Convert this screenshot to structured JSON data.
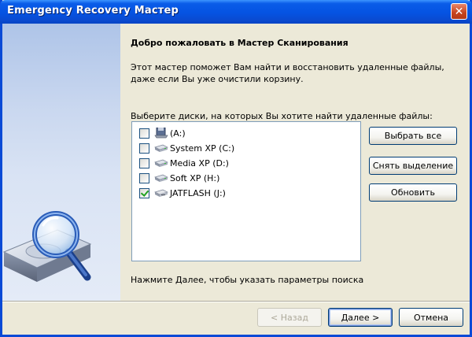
{
  "window": {
    "title": "Emergency Recovery Мастер",
    "close_glyph": "✕"
  },
  "content": {
    "heading": "Добро пожаловать в Мастер Сканирования",
    "description": "Этот мастер поможет Вам найти и восстановить удаленные файлы, даже если Вы уже очистили корзину.",
    "list_label": "Выберите диски, на которых Вы хотите найти удаленные файлы:",
    "drives": [
      {
        "label": "(A:)",
        "checked": false,
        "icon": "floppy-drive-icon"
      },
      {
        "label": "System XP (C:)",
        "checked": false,
        "icon": "hard-drive-icon"
      },
      {
        "label": "Media XP (D:)",
        "checked": false,
        "icon": "hard-drive-icon"
      },
      {
        "label": "Soft XP (H:)",
        "checked": false,
        "icon": "hard-drive-icon"
      },
      {
        "label": "JATFLASH (J:)",
        "checked": true,
        "icon": "removable-drive-icon"
      }
    ],
    "select_all_label": "Выбрать все",
    "deselect_label": "Снять выделение",
    "refresh_label": "Обновить",
    "hint": "Нажмите Далее, чтобы указать параметры поиска"
  },
  "footer": {
    "back_label": "< Назад",
    "next_label": "Далее >",
    "cancel_label": "Отмена"
  },
  "colors": {
    "titlebar": "#0553e2",
    "sidebar_top": "#aec4e8",
    "window_bg": "#ece9d8",
    "list_border": "#7f9db9"
  }
}
